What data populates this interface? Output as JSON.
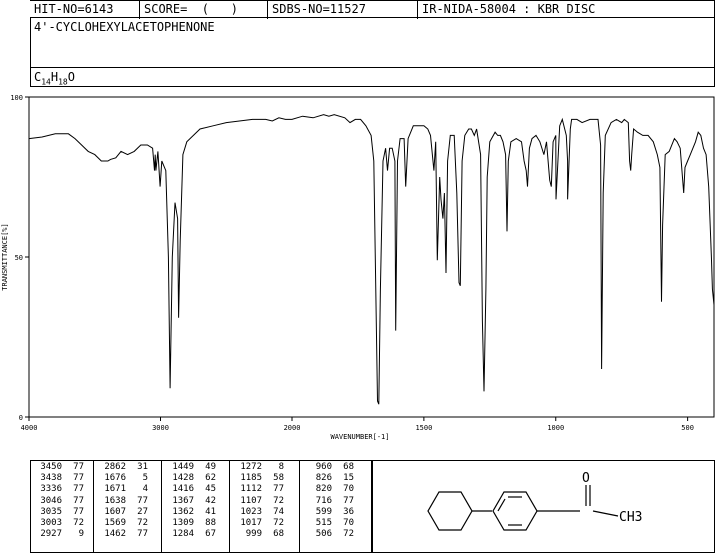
{
  "header": {
    "hit_no": "HIT-NO=6143",
    "score": "SCORE=  (   )",
    "sdbs_no": "SDBS-NO=11527",
    "ir_id": "IR-NIDA-58004 : KBR DISC"
  },
  "compound_name": "4'-CYCLOHEXYLACETOPHENONE",
  "formula": {
    "c": "C",
    "c_n": "14",
    "h": "H",
    "h_n": "18",
    "o": "O"
  },
  "chart_data": {
    "type": "line",
    "xlabel": "WAVENUMBER[-1]",
    "ylabel": "TRANSMITTANCE[%]",
    "xlim": [
      4000,
      400
    ],
    "ylim": [
      0,
      100
    ],
    "x_ticks": [
      "4000",
      "3000",
      "2000",
      "1500",
      "1000",
      "500"
    ],
    "y_ticks": [
      "100",
      "50",
      "0"
    ],
    "x_axis_scale": "two linear segments: 4000-2000 and 2000-400 (expanded)",
    "series": [
      {
        "points": [
          [
            4000,
            87
          ],
          [
            3900,
            87.5
          ],
          [
            3800,
            88.5
          ],
          [
            3700,
            88.5
          ],
          [
            3650,
            87
          ],
          [
            3600,
            85
          ],
          [
            3550,
            83
          ],
          [
            3500,
            82
          ],
          [
            3450,
            80
          ],
          [
            3400,
            80
          ],
          [
            3380,
            80.5
          ],
          [
            3340,
            81
          ],
          [
            3300,
            83
          ],
          [
            3250,
            82
          ],
          [
            3200,
            83
          ],
          [
            3150,
            85
          ],
          [
            3100,
            85
          ],
          [
            3060,
            84
          ],
          [
            3046,
            77
          ],
          [
            3040,
            82
          ],
          [
            3035,
            77
          ],
          [
            3020,
            83
          ],
          [
            3003,
            72
          ],
          [
            2990,
            80
          ],
          [
            2960,
            77
          ],
          [
            2940,
            50
          ],
          [
            2927,
            9
          ],
          [
            2910,
            50
          ],
          [
            2890,
            67
          ],
          [
            2870,
            62
          ],
          [
            2862,
            31
          ],
          [
            2850,
            55
          ],
          [
            2830,
            82
          ],
          [
            2800,
            86
          ],
          [
            2700,
            90
          ],
          [
            2600,
            91
          ],
          [
            2500,
            92
          ],
          [
            2400,
            92.5
          ],
          [
            2300,
            93
          ],
          [
            2200,
            93
          ],
          [
            2150,
            92.5
          ],
          [
            2100,
            93.5
          ],
          [
            2050,
            93
          ],
          [
            2000,
            93
          ],
          [
            1960,
            94
          ],
          [
            1920,
            93.5
          ],
          [
            1880,
            94.5
          ],
          [
            1860,
            94
          ],
          [
            1840,
            94.5
          ],
          [
            1800,
            93.5
          ],
          [
            1780,
            92
          ],
          [
            1760,
            93
          ],
          [
            1740,
            93
          ],
          [
            1720,
            91
          ],
          [
            1700,
            88
          ],
          [
            1690,
            80
          ],
          [
            1676,
            5
          ],
          [
            1671,
            4
          ],
          [
            1665,
            40
          ],
          [
            1655,
            80
          ],
          [
            1645,
            84
          ],
          [
            1638,
            77
          ],
          [
            1630,
            84
          ],
          [
            1620,
            84
          ],
          [
            1610,
            80
          ],
          [
            1607,
            27
          ],
          [
            1600,
            80
          ],
          [
            1590,
            87
          ],
          [
            1575,
            87
          ],
          [
            1569,
            72
          ],
          [
            1560,
            87
          ],
          [
            1540,
            91
          ],
          [
            1520,
            91
          ],
          [
            1500,
            91
          ],
          [
            1485,
            90
          ],
          [
            1475,
            88
          ],
          [
            1462,
            77
          ],
          [
            1455,
            86
          ],
          [
            1449,
            49
          ],
          [
            1440,
            75
          ],
          [
            1435,
            68
          ],
          [
            1428,
            62
          ],
          [
            1422,
            70
          ],
          [
            1416,
            45
          ],
          [
            1410,
            80
          ],
          [
            1400,
            88
          ],
          [
            1385,
            88
          ],
          [
            1375,
            70
          ],
          [
            1367,
            42
          ],
          [
            1362,
            41
          ],
          [
            1355,
            80
          ],
          [
            1345,
            88
          ],
          [
            1330,
            90
          ],
          [
            1320,
            90
          ],
          [
            1309,
            88
          ],
          [
            1300,
            90
          ],
          [
            1285,
            82
          ],
          [
            1278,
            30
          ],
          [
            1272,
            8
          ],
          [
            1265,
            40
          ],
          [
            1260,
            75
          ],
          [
            1250,
            86
          ],
          [
            1230,
            89
          ],
          [
            1220,
            88
          ],
          [
            1210,
            88
          ],
          [
            1200,
            86
          ],
          [
            1190,
            82
          ],
          [
            1185,
            58
          ],
          [
            1180,
            80
          ],
          [
            1170,
            86
          ],
          [
            1150,
            87
          ],
          [
            1130,
            86
          ],
          [
            1120,
            80
          ],
          [
            1112,
            77
          ],
          [
            1107,
            72
          ],
          [
            1100,
            84
          ],
          [
            1090,
            87
          ],
          [
            1075,
            88
          ],
          [
            1060,
            86
          ],
          [
            1045,
            82
          ],
          [
            1035,
            86
          ],
          [
            1023,
            74
          ],
          [
            1017,
            72
          ],
          [
            1010,
            86
          ],
          [
            1000,
            88
          ],
          [
            999,
            68
          ],
          [
            985,
            91
          ],
          [
            975,
            93
          ],
          [
            960,
            88
          ],
          [
            955,
            80
          ],
          [
            955,
            68
          ],
          [
            945,
            90
          ],
          [
            940,
            93
          ],
          [
            920,
            93
          ],
          [
            900,
            92
          ],
          [
            870,
            93
          ],
          [
            840,
            93
          ],
          [
            830,
            85
          ],
          [
            826,
            15
          ],
          [
            820,
            70
          ],
          [
            812,
            88
          ],
          [
            790,
            92
          ],
          [
            770,
            93
          ],
          [
            750,
            92
          ],
          [
            740,
            93
          ],
          [
            725,
            92
          ],
          [
            720,
            80
          ],
          [
            716,
            77
          ],
          [
            712,
            82
          ],
          [
            705,
            90
          ],
          [
            690,
            89
          ],
          [
            670,
            88
          ],
          [
            650,
            88
          ],
          [
            630,
            86
          ],
          [
            615,
            82
          ],
          [
            605,
            78
          ],
          [
            599,
            36
          ],
          [
            595,
            60
          ],
          [
            585,
            82
          ],
          [
            570,
            83
          ],
          [
            550,
            87
          ],
          [
            540,
            86
          ],
          [
            528,
            84
          ],
          [
            515,
            70
          ],
          [
            510,
            78
          ],
          [
            500,
            80
          ],
          [
            490,
            82
          ],
          [
            480,
            84
          ],
          [
            470,
            86
          ],
          [
            460,
            89
          ],
          [
            450,
            88
          ],
          [
            440,
            84
          ],
          [
            430,
            82
          ],
          [
            420,
            72
          ],
          [
            410,
            50
          ],
          [
            406,
            40
          ],
          [
            400,
            35
          ]
        ]
      }
    ]
  },
  "peak_table": [
    [
      [
        "3450",
        "77"
      ],
      [
        "3438",
        "77"
      ],
      [
        "3336",
        "77"
      ],
      [
        "3046",
        "77"
      ],
      [
        "3035",
        "77"
      ],
      [
        "3003",
        "72"
      ],
      [
        "2927",
        "9"
      ]
    ],
    [
      [
        "2862",
        "31"
      ],
      [
        "1676",
        "5"
      ],
      [
        "1671",
        "4"
      ],
      [
        "1638",
        "77"
      ],
      [
        "1607",
        "27"
      ],
      [
        "1569",
        "72"
      ],
      [
        "1462",
        "77"
      ]
    ],
    [
      [
        "1449",
        "49"
      ],
      [
        "1428",
        "62"
      ],
      [
        "1416",
        "45"
      ],
      [
        "1367",
        "42"
      ],
      [
        "1362",
        "41"
      ],
      [
        "1309",
        "88"
      ],
      [
        "1284",
        "67"
      ]
    ],
    [
      [
        "1272",
        "8"
      ],
      [
        "1185",
        "58"
      ],
      [
        "1112",
        "77"
      ],
      [
        "1107",
        "72"
      ],
      [
        "1023",
        "74"
      ],
      [
        "1017",
        "72"
      ],
      [
        "999",
        "68"
      ]
    ],
    [
      [
        "960",
        "68"
      ],
      [
        "826",
        "15"
      ],
      [
        "820",
        "70"
      ],
      [
        "716",
        "77"
      ],
      [
        "599",
        "36"
      ],
      [
        "515",
        "70"
      ],
      [
        "506",
        "72"
      ]
    ]
  ],
  "structure_labels": {
    "carbonyl_o": "O",
    "methyl": "CH3"
  }
}
